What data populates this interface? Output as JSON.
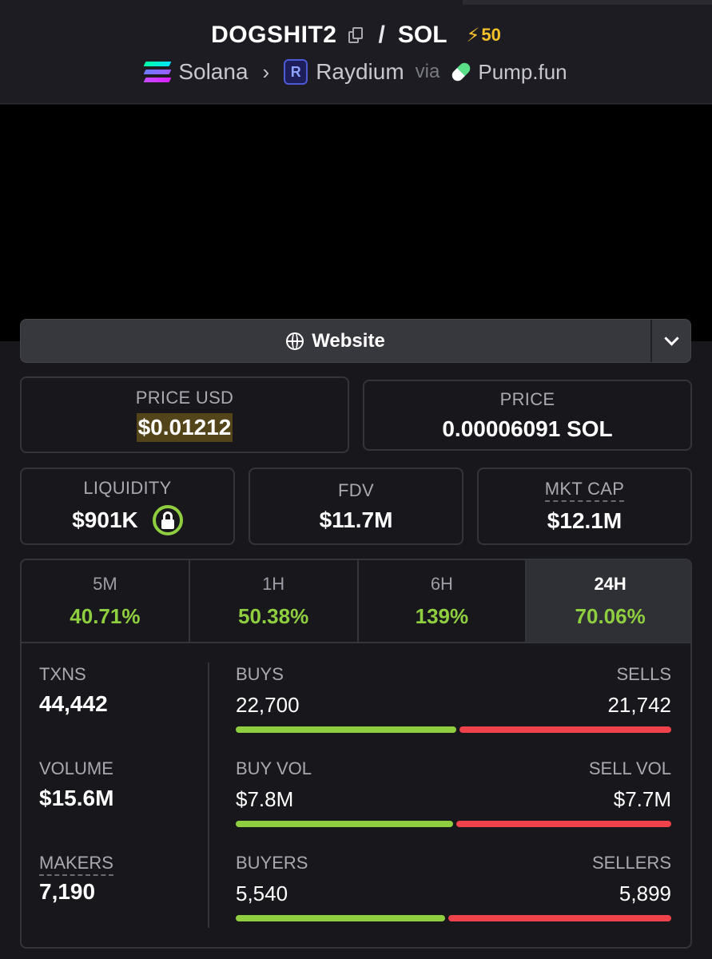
{
  "header": {
    "base_symbol": "DOGSHIT2",
    "separator": "/",
    "quote_symbol": "SOL",
    "boost_count": "50",
    "chain": "Solana",
    "dex": "Raydium",
    "via_label": "via",
    "launchpad": "Pump.fun"
  },
  "website_button": {
    "label": "Website"
  },
  "price": {
    "usd_label": "PRICE USD",
    "usd_value": "$0.01212",
    "native_label": "PRICE",
    "native_value": "0.00006091 SOL"
  },
  "metrics": {
    "liquidity_label": "LIQUIDITY",
    "liquidity_value": "$901K",
    "fdv_label": "FDV",
    "fdv_value": "$11.7M",
    "mktcap_label": "MKT CAP",
    "mktcap_value": "$12.1M"
  },
  "timeframes": [
    {
      "label": "5M",
      "change": "40.71%",
      "active": false
    },
    {
      "label": "1H",
      "change": "50.38%",
      "active": false
    },
    {
      "label": "6H",
      "change": "139%",
      "active": false
    },
    {
      "label": "24H",
      "change": "70.06%",
      "active": true
    }
  ],
  "stats": {
    "txns_label": "TXNS",
    "txns_value": "44,442",
    "volume_label": "VOLUME",
    "volume_value": "$15.6M",
    "makers_label": "MAKERS",
    "makers_value": "7,190"
  },
  "ratios": {
    "buys_label": "BUYS",
    "buys_value": "22,700",
    "sells_label": "SELLS",
    "sells_value": "21,742",
    "buys_fraction": 0.511,
    "buy_vol_label": "BUY VOL",
    "buy_vol_value": "$7.8M",
    "sell_vol_label": "SELL VOL",
    "sell_vol_value": "$7.7M",
    "buy_vol_fraction": 0.503,
    "buyers_label": "BUYERS",
    "buyers_value": "5,540",
    "sellers_label": "SELLERS",
    "sellers_value": "5,899",
    "buyers_fraction": 0.484
  },
  "colors": {
    "positive": "#8fce3f",
    "negative": "#f0424a",
    "boost": "#f5c12a"
  }
}
